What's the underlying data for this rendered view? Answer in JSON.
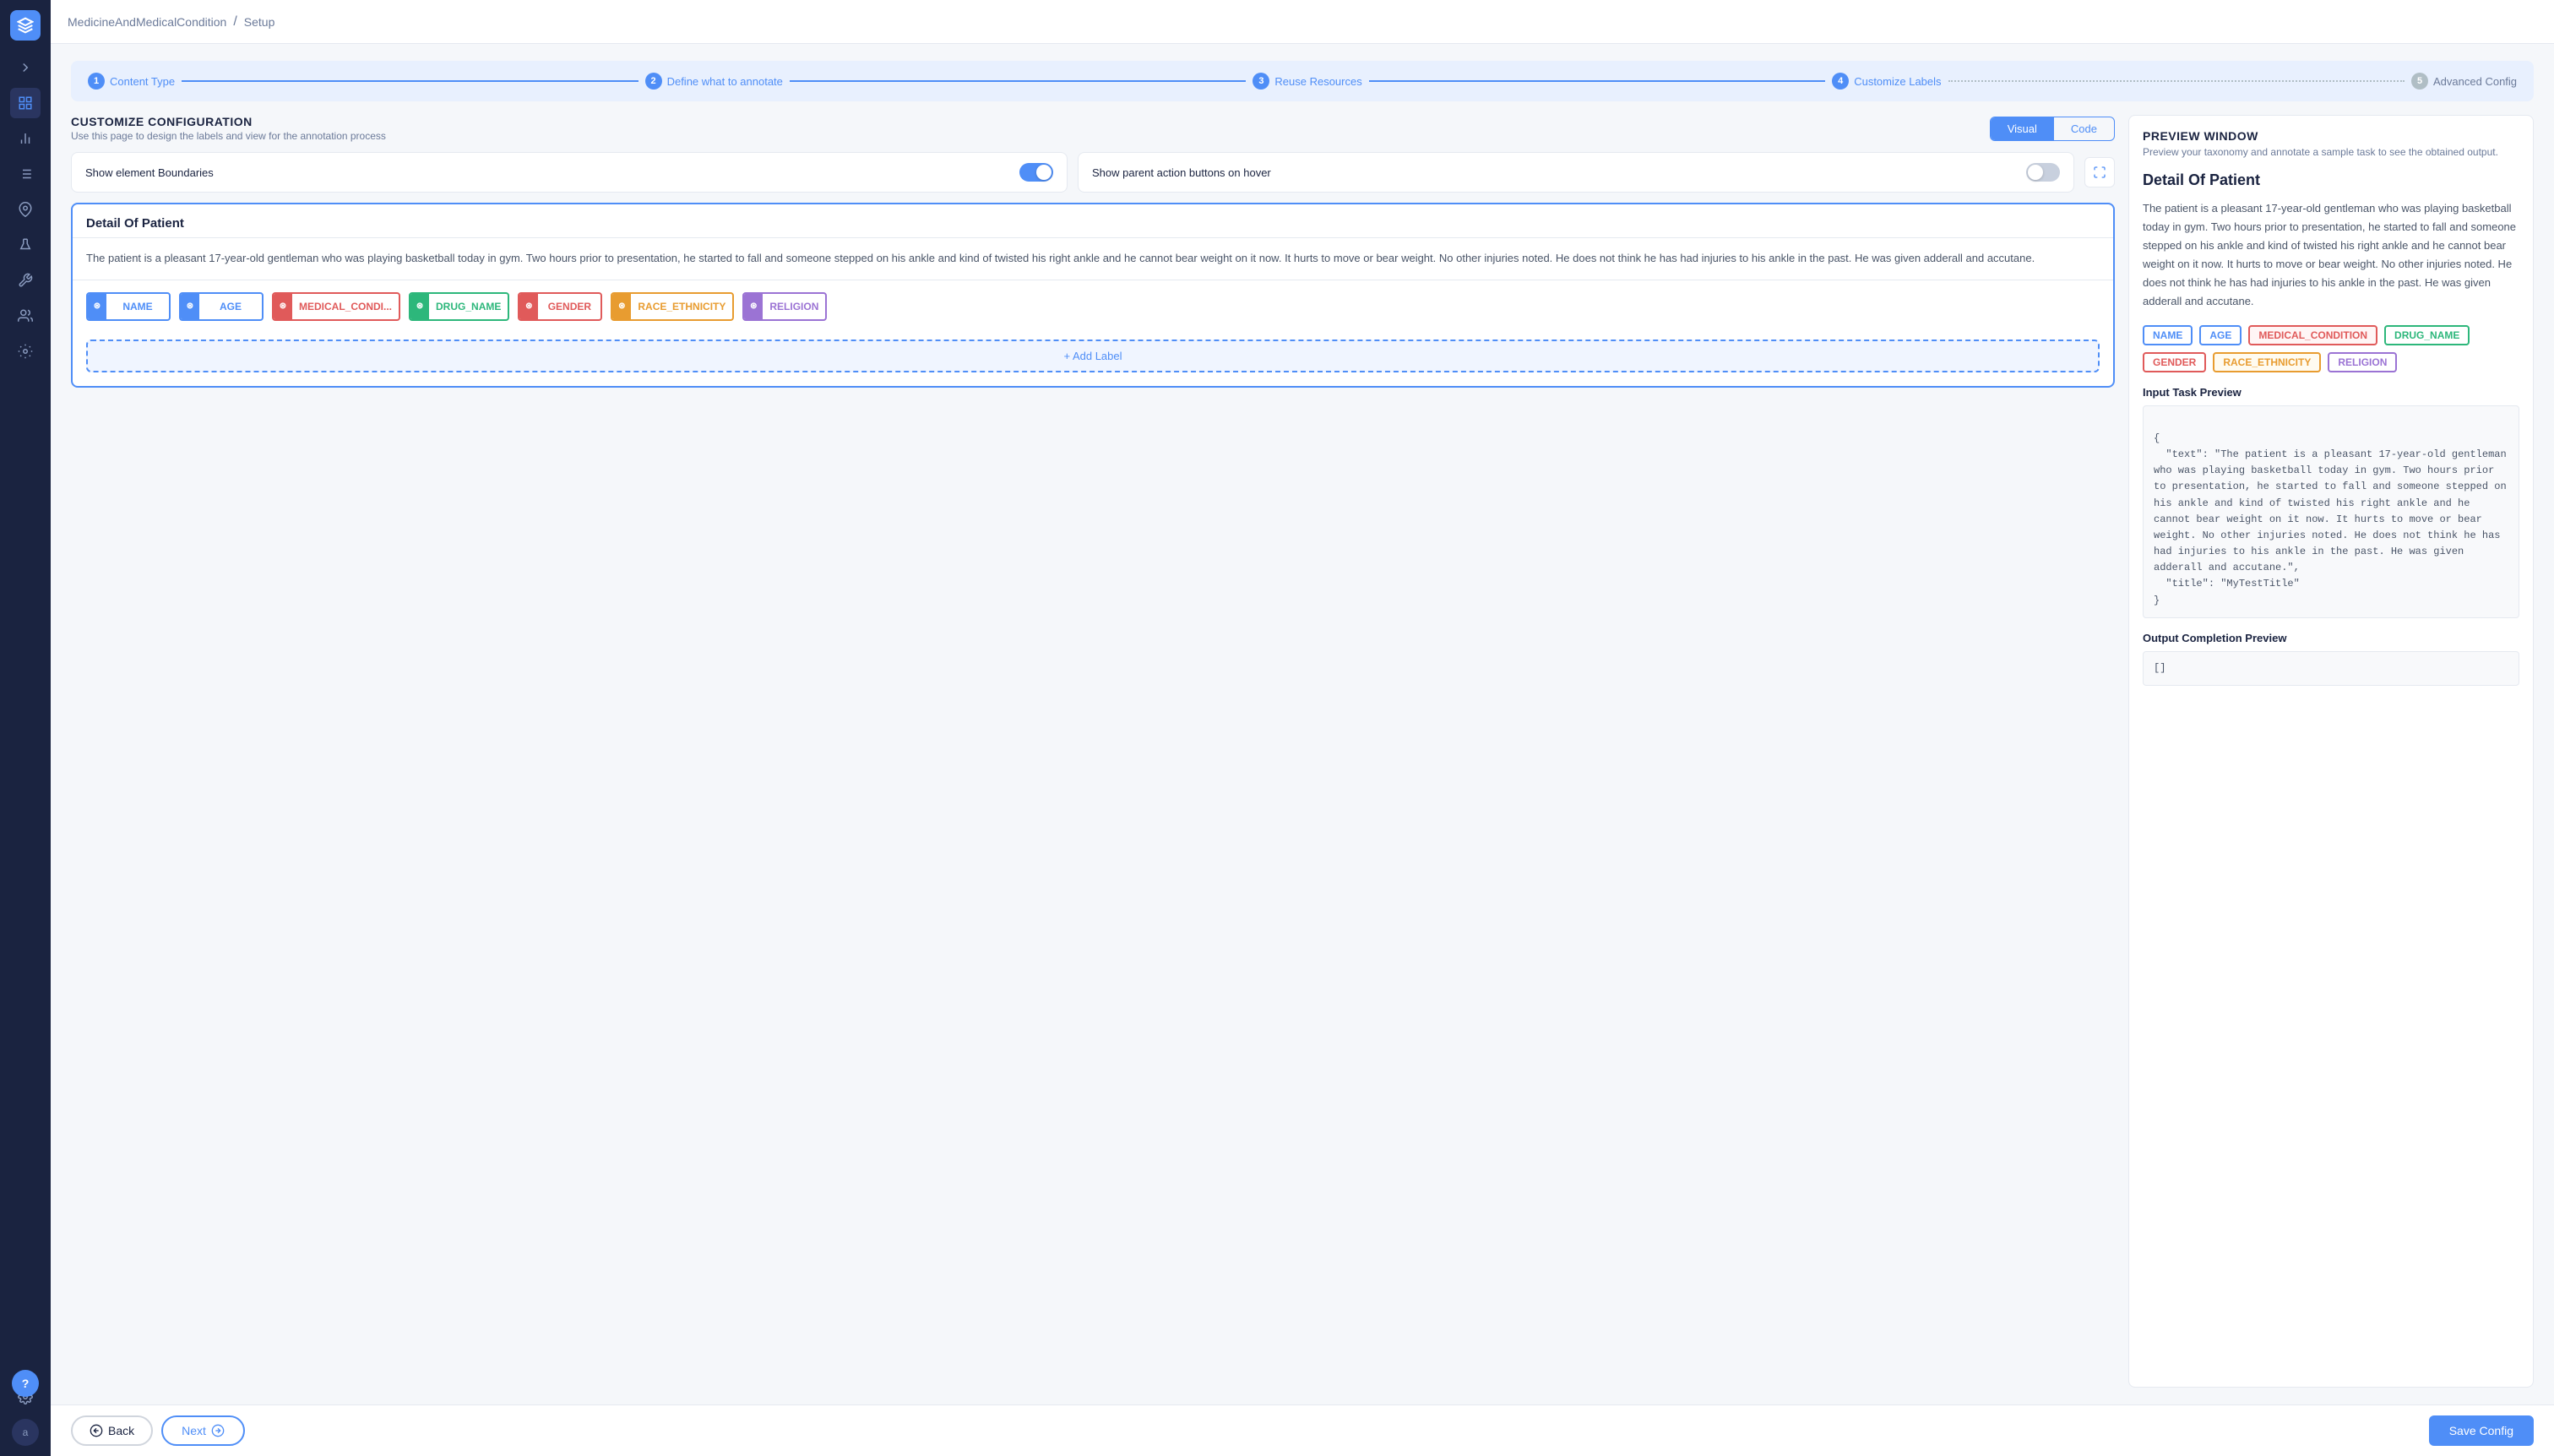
{
  "app": {
    "logo": "U",
    "breadcrumb_project": "MedicineAndMedicalCondition",
    "breadcrumb_separator": "/",
    "breadcrumb_current": "Setup"
  },
  "steps": [
    {
      "num": "1",
      "label": "Content Type",
      "active": true
    },
    {
      "num": "2",
      "label": "Define what to annotate",
      "active": true
    },
    {
      "num": "3",
      "label": "Reuse Resources",
      "active": true
    },
    {
      "num": "4",
      "label": "Customize Labels",
      "active": true
    },
    {
      "num": "5",
      "label": "Advanced Config",
      "active": false
    }
  ],
  "left_panel": {
    "title": "CUSTOMIZE CONFIGURATION",
    "subtitle": "Use this page to design the labels and view for the annotation process",
    "view_visual_label": "Visual",
    "view_code_label": "Code",
    "toggle_boundaries_label": "Show element Boundaries",
    "toggle_boundaries_on": true,
    "toggle_hover_label": "Show parent action buttons on hover",
    "toggle_hover_on": false,
    "detail_title": "Detail Of Patient",
    "detail_text": "The patient is a pleasant 17-year-old gentleman who was playing basketball today in gym. Two hours prior to presentation, he started to fall and someone stepped on his ankle and kind of twisted his right ankle and he cannot bear weight on it now. It hurts to move or bear weight. No other injuries noted. He does not think he has had injuries to his ankle in the past. He was given adderall and accutane.",
    "labels": [
      {
        "id": "name",
        "text": "NAME",
        "color": "#4f8ef7",
        "bg": "#4f8ef7"
      },
      {
        "id": "age",
        "text": "AGE",
        "color": "#4f8ef7",
        "bg": "#4f8ef7"
      },
      {
        "id": "medical_cond",
        "text": "MEDICAL_CONDI...",
        "color": "#e05a5a",
        "bg": "#e05a5a"
      },
      {
        "id": "drug_name",
        "text": "DRUG_NAME",
        "color": "#2db77b",
        "bg": "#2db77b"
      },
      {
        "id": "gender",
        "text": "GENDER",
        "color": "#e05a5a",
        "bg": "#e05a5a"
      },
      {
        "id": "race_ethnicity",
        "text": "RACE_ETHNICITY",
        "color": "#e89c30",
        "bg": "#e89c30"
      },
      {
        "id": "religion",
        "text": "RELIGION",
        "color": "#9b73d4",
        "bg": "#9b73d4"
      }
    ],
    "add_label_text": "+ Add Label"
  },
  "right_panel": {
    "title": "PREVIEW WINDOW",
    "subtitle": "Preview your taxonomy and annotate a sample task to see the obtained output.",
    "content_title": "Detail Of Patient",
    "content_text": "The patient is a pleasant 17-year-old gentleman who was playing basketball today in gym. Two hours prior to presentation, he started to fall and someone stepped on his ankle and kind of twisted his right ankle and he cannot bear weight on it now. It hurts to move or bear weight. No other injuries noted. He does not think he has had injuries to his ankle in the past. He was given adderall and accutane.",
    "tags": [
      {
        "id": "name",
        "text": "NAME",
        "color": "#4f8ef7"
      },
      {
        "id": "age",
        "text": "AGE",
        "color": "#4f8ef7"
      },
      {
        "id": "medical_condition",
        "text": "MEDICAL_CONDITION",
        "color": "#e05a5a"
      },
      {
        "id": "drug_name",
        "text": "DRUG_NAME",
        "color": "#2db77b"
      },
      {
        "id": "gender",
        "text": "GENDER",
        "color": "#e05a5a"
      },
      {
        "id": "race_ethnicity",
        "text": "RACE_ETHNICITY",
        "color": "#e89c30"
      },
      {
        "id": "religion",
        "text": "RELIGION",
        "color": "#9b73d4"
      }
    ],
    "input_preview_label": "Input Task Preview",
    "input_preview_code": "{\n  \"text\": \"The patient is a pleasant 17-year-old gentleman who was playing basketball today in gym. Two hours prior to presentation, he started to fall and someone stepped on his ankle and kind of twisted his right ankle and he cannot bear weight on it now. It hurts to move or bear weight. No other injuries noted. He does not think he has had injuries to his ankle in the past. He was given adderall and accutane.\",\n  \"title\": \"MyTestTitle\"\n}",
    "output_preview_label": "Output Completion Preview",
    "output_preview_code": "[]"
  },
  "footer": {
    "back_label": "Back",
    "next_label": "Next",
    "save_label": "Save Config"
  }
}
